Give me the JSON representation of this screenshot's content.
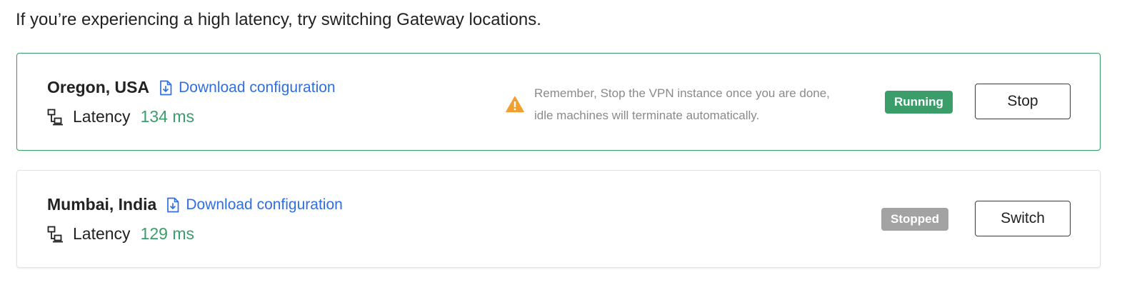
{
  "intro_text": "If you’re experiencing a high latency, try switching Gateway locations.",
  "colors": {
    "accent_green": "#3a9d6a",
    "link_blue": "#2f6fe0",
    "stopped_gray": "#a3a3a3",
    "warning_orange": "#f0a030"
  },
  "icons": {
    "download": "file-download-icon",
    "latency": "network-icon",
    "warning": "warning-triangle-icon"
  },
  "gateways": [
    {
      "location": "Oregon, USA",
      "download_label": "Download configuration",
      "latency_label": "Latency",
      "latency_value": "134 ms",
      "warning_line1": "Remember, Stop the VPN instance once you are done,",
      "warning_line2": "idle machines will terminate automatically.",
      "status": "Running",
      "action_label": "Stop"
    },
    {
      "location": "Mumbai, India",
      "download_label": "Download configuration",
      "latency_label": "Latency",
      "latency_value": "129 ms",
      "status": "Stopped",
      "action_label": "Switch"
    }
  ]
}
